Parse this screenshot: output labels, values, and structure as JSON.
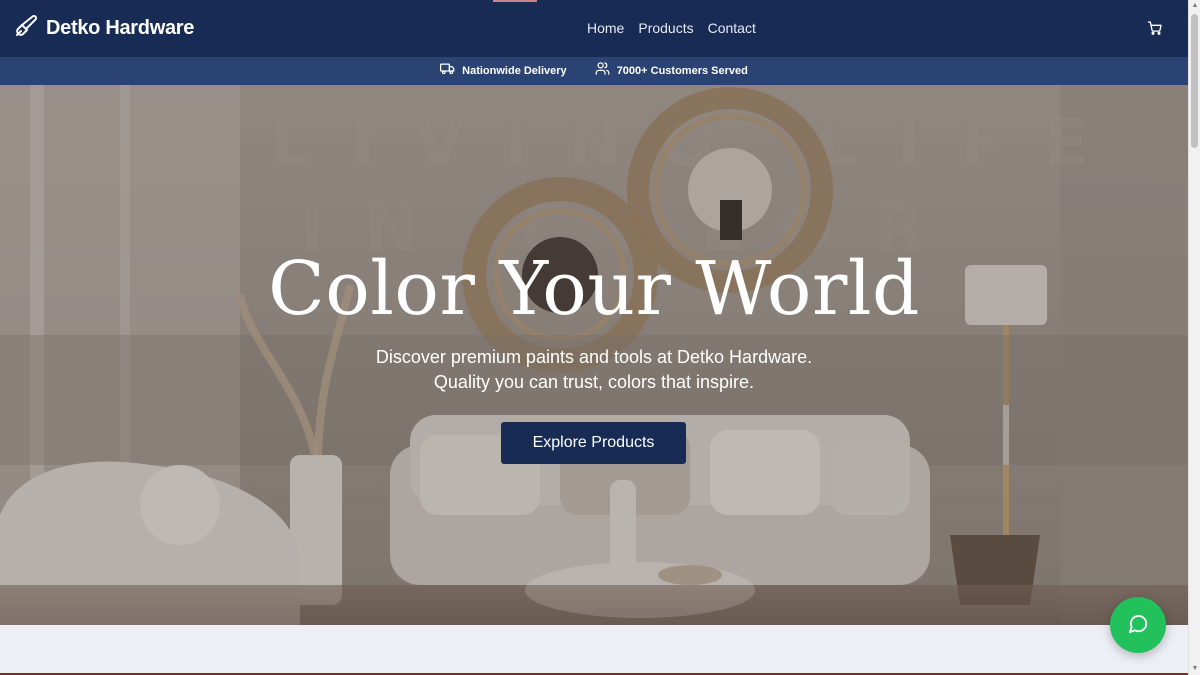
{
  "header": {
    "brand_name": "Detko Hardware",
    "nav": [
      {
        "label": "Home"
      },
      {
        "label": "Products"
      },
      {
        "label": "Contact"
      }
    ]
  },
  "infobar": {
    "items": [
      {
        "label": "Nationwide Delivery",
        "icon": "truck-icon"
      },
      {
        "label": "7000+ Customers Served",
        "icon": "users-icon"
      }
    ]
  },
  "hero": {
    "title": "Color Your World",
    "subtitle_line1": "Discover premium paints and tools at Detko Hardware.",
    "subtitle_line2": "Quality you can trust, colors that inspire.",
    "button_label": "Explore Products",
    "background_description": "living room interior with rattan mirrors, sofa, armchair, floor lamp"
  },
  "colors": {
    "navbar": "#172b54",
    "infobar": "#2a4372",
    "accent_button": "#172b54",
    "chat_button": "#23c15c",
    "lower_strip": "#edeff7"
  },
  "icons": {
    "brand": "paint-brush-icon",
    "cart": "shopping-cart-icon",
    "chat": "chat-bubble-icon"
  }
}
